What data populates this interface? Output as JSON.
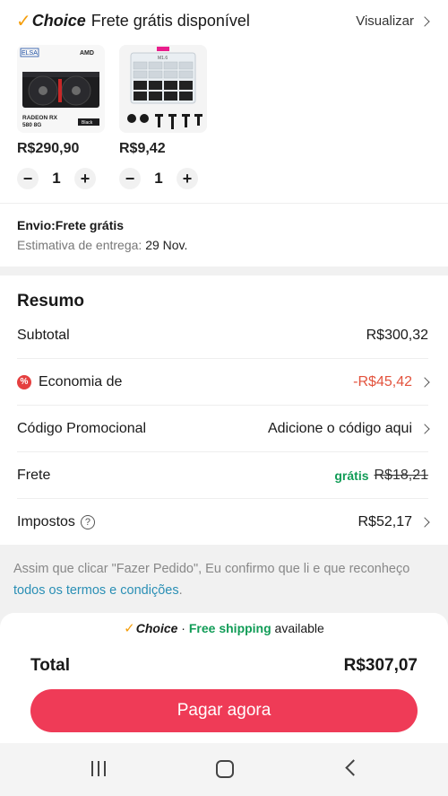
{
  "header": {
    "check_glyph": "✓",
    "choice_label": "Choice",
    "title": "Frete grátis disponível",
    "view_label": "Visualizar"
  },
  "products": [
    {
      "image_brand": "ELSA",
      "image_chip": "AMD",
      "image_model_line1": "RADEON RX",
      "image_model_line2": "580 8G",
      "image_tag": "Black",
      "price": "R$290,90",
      "quantity": "1"
    },
    {
      "image_label": "M1.6",
      "price": "R$9,42",
      "quantity": "1"
    }
  ],
  "stepper": {
    "minus": "−",
    "plus": "+"
  },
  "shipping": {
    "envio": "Envio:Frete grátis",
    "estimate_label": "Estimativa de entrega:",
    "estimate_date": "29 Nov."
  },
  "summary": {
    "title": "Resumo",
    "subtotal_label": "Subtotal",
    "subtotal_value": "R$300,32",
    "savings_badge": "%",
    "savings_label": "Economia de",
    "savings_value": "-R$45,42",
    "promo_label": "Código Promocional",
    "promo_value": "Adicione o código aqui",
    "shipping_label": "Frete",
    "shipping_free": "grátis",
    "shipping_original": "R$18,21",
    "tax_label": "Impostos",
    "tax_help": "?",
    "tax_value": "R$52,17"
  },
  "terms": {
    "text": "Assim que clicar \"Fazer Pedido\", Eu confirmo que li e que reconheço ",
    "link": "todos os termos e condições",
    "end": "."
  },
  "bottom": {
    "check_glyph": "✓",
    "choice": "Choice",
    "separator": " · ",
    "free_shipping": "Free shipping",
    "available": " available",
    "total_label": "Total",
    "total_value": "R$307,07",
    "pay_label": "Pagar agora"
  },
  "colors": {
    "accent": "#ef3b57",
    "green": "#119c57",
    "red": "#e3533d",
    "link": "#2a8fb5",
    "choice_check": "#f59e0b"
  }
}
